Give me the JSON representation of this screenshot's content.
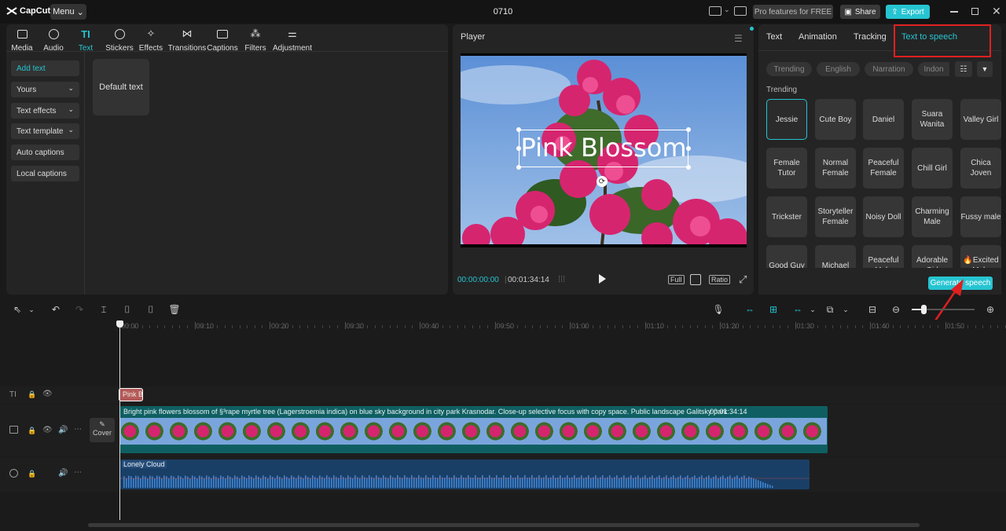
{
  "app": {
    "logo": "CapCut",
    "menu_label": "Menu",
    "project_title": "0710"
  },
  "topbar": {
    "pro_label": "Pro features for FREE",
    "share_label": "Share",
    "export_label": "Export"
  },
  "toolbar": {
    "tabs": [
      {
        "label": "Media",
        "icon": "media-icon"
      },
      {
        "label": "Audio",
        "icon": "audio-icon"
      },
      {
        "label": "Text",
        "icon": "text-icon",
        "active": true
      },
      {
        "label": "Stickers",
        "icon": "sticker-icon"
      },
      {
        "label": "Effects",
        "icon": "effects-icon"
      },
      {
        "label": "Transitions",
        "icon": "transitions-icon"
      },
      {
        "label": "Captions",
        "icon": "captions-icon"
      },
      {
        "label": "Filters",
        "icon": "filters-icon"
      },
      {
        "label": "Adjustment",
        "icon": "adjustment-icon"
      }
    ]
  },
  "sidebar": {
    "items": [
      "Add text",
      "Yours",
      "Text effects",
      "Text template",
      "Auto captions",
      "Local captions"
    ]
  },
  "content": {
    "default_text_card": "Default text"
  },
  "player": {
    "title": "Player",
    "overlay_text": "Pink Blossom",
    "current_time": "00:00:00:00",
    "total_time": "00:01:34:14",
    "full_label": "Full",
    "ratio_label": "Ratio"
  },
  "right_panel": {
    "tabs": [
      "Text",
      "Animation",
      "Tracking",
      "Text to speech"
    ],
    "filters": [
      "Trending",
      "English",
      "Narration",
      "Indon"
    ],
    "section_label": "Trending",
    "voices": [
      [
        "Jessie",
        "Cute Boy",
        "Daniel",
        "Suara Wanita",
        "Valley Girl"
      ],
      [
        "Female Tutor",
        "Normal Female",
        "Peaceful Female",
        "Chill Girl",
        "Chica Joven"
      ],
      [
        "Trickster",
        "Storyteller Female",
        "Noisy Doll",
        "Charming Male",
        "Fussy male"
      ],
      [
        "Good Guy",
        "Michael",
        "Peaceful Male",
        "Adorable Girl",
        "🔥Excited Male"
      ]
    ],
    "generate_label": "Generate speech"
  },
  "timeline": {
    "ruler": [
      "00:00",
      "00:10",
      "00:20",
      "00:30",
      "00:40",
      "00:50",
      "01:00",
      "01:10",
      "01:20",
      "01:30",
      "01:40",
      "01:50"
    ],
    "text_clip": "Pink B",
    "video_clip_title": "Bright pink flowers blossom  of §³rape myrtle tree (Lagerstroemia indica) on blue sky background in city park Krasnodar. Close-up selective focus with copy space. Public landscape Galitsky park",
    "video_clip_duration": "00:01:34:14",
    "cover_label": "Cover",
    "audio_clip": "Lonely Cloud"
  },
  "colors": {
    "accent": "#26c4d1",
    "highlight_box": "#e02020",
    "text_clip": "#b55a5a",
    "video_clip": "#0f5f62",
    "audio_clip": "#1a3f66"
  }
}
